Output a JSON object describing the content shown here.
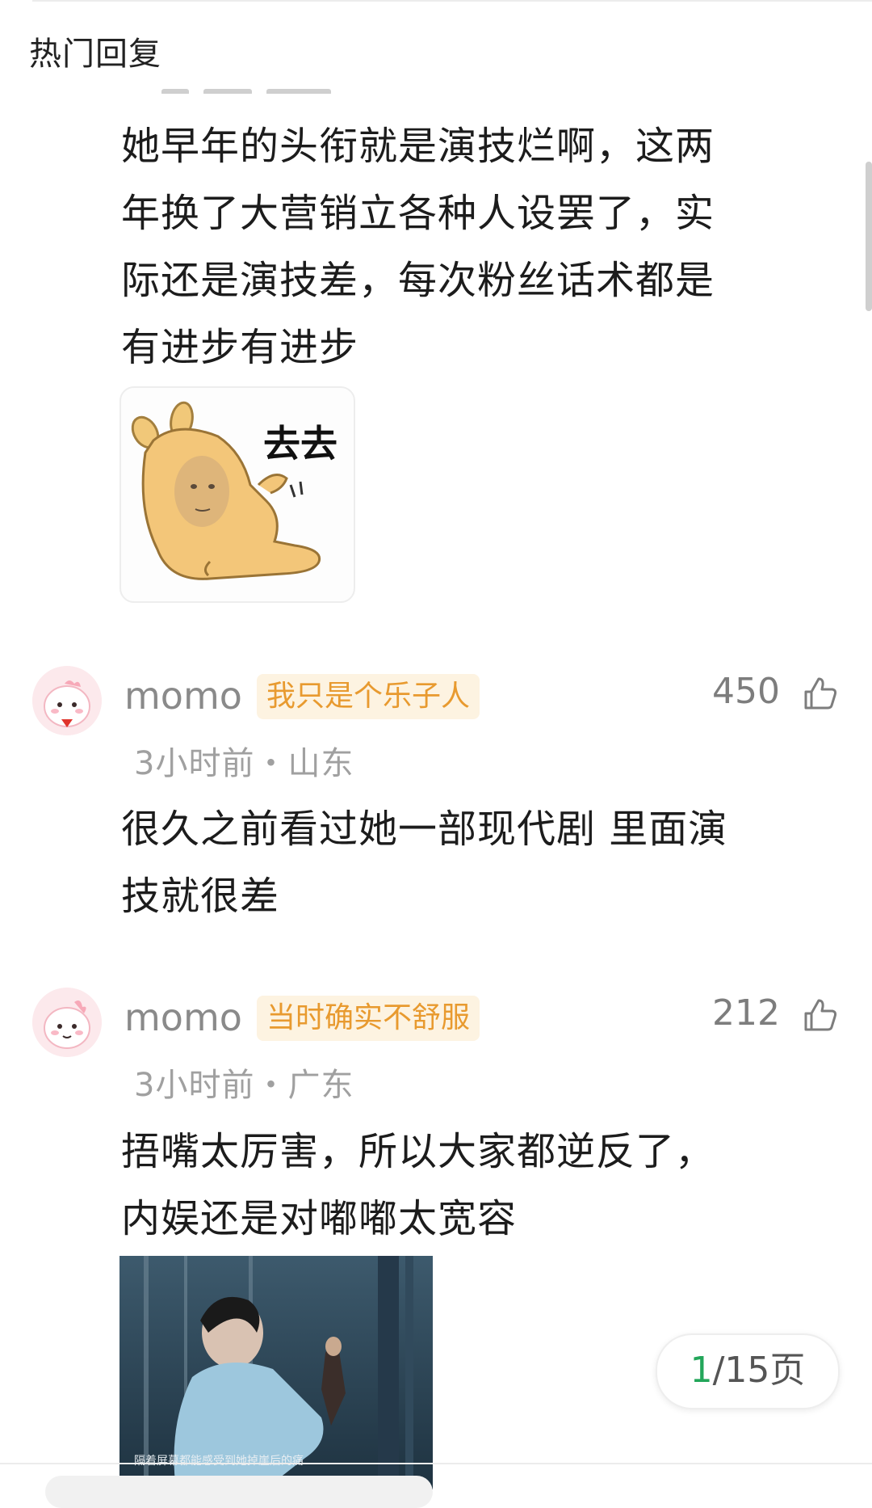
{
  "section": {
    "title": "热门回复"
  },
  "comments": [
    {
      "body_lines": [
        "她早年的头衔就是演技烂啊，这两",
        "年换了大营销立各种人设罢了，实",
        "际还是演技差，每次粉丝话术都是",
        "有进步有进步"
      ],
      "sticker": {
        "text": "去去",
        "icon": "capybara-sticker"
      }
    },
    {
      "username": "momo",
      "badge": "我只是个乐子人",
      "likes": "450",
      "meta": "3小时前・山东",
      "body_lines": [
        "很久之前看过她一部现代剧 里面演",
        "技就很差"
      ]
    },
    {
      "username": "momo",
      "badge": "当时确实不舒服",
      "likes": "212",
      "meta": "3小时前・广东",
      "body_lines": [
        "捂嘴太厉害，所以大家都逆反了，",
        "内娱还是对嘟嘟太宽容"
      ],
      "image": {
        "caption": "隔着屏幕都能感受到她掉崖后的痛"
      }
    }
  ],
  "pager": {
    "current": "1",
    "total": "/15页"
  },
  "colors": {
    "badge_text": "#e89a2f",
    "badge_bg": "#fdf3e1",
    "pager_current": "#23a65a"
  }
}
